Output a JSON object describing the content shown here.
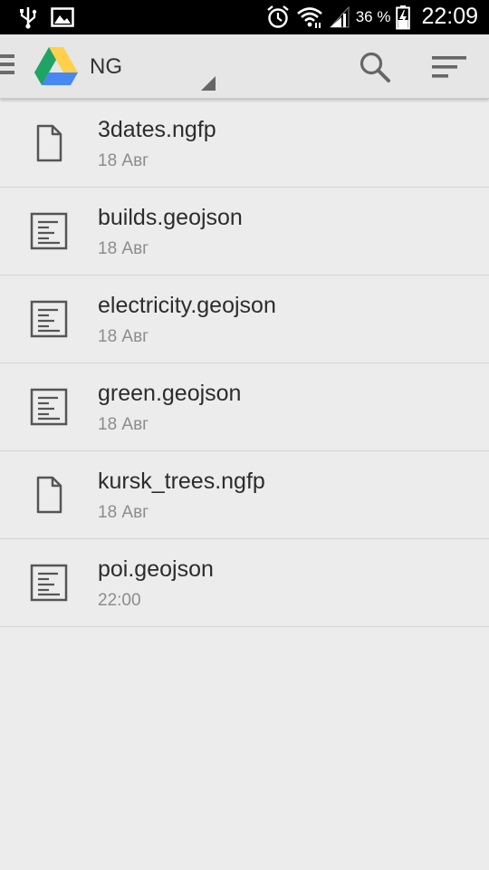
{
  "status_bar": {
    "battery_percent": "36 %",
    "time": "22:09",
    "icons": [
      "usb-icon",
      "image-icon",
      "alarm-icon",
      "wifi-icon",
      "signal-icon",
      "battery-charging-icon"
    ]
  },
  "app_bar": {
    "account": "NG",
    "icons": [
      "menu-icon",
      "drive-logo",
      "search-icon",
      "sort-icon"
    ]
  },
  "files": [
    {
      "name": "3dates.ngfp",
      "date": "18 Авг",
      "icon": "file-icon"
    },
    {
      "name": "builds.geojson",
      "date": "18 Авг",
      "icon": "text-document-icon"
    },
    {
      "name": "electricity.geojson",
      "date": "18 Авг",
      "icon": "text-document-icon"
    },
    {
      "name": "green.geojson",
      "date": "18 Авг",
      "icon": "text-document-icon"
    },
    {
      "name": "kursk_trees.ngfp",
      "date": "18 Авг",
      "icon": "file-icon"
    },
    {
      "name": "poi.geojson",
      "date": "22:00",
      "icon": "text-document-icon"
    }
  ],
  "colors": {
    "background": "#ececec",
    "app_bar": "#e6e6e6",
    "primary_text": "#2c2c2c",
    "secondary_text": "#8c8c8c",
    "drive_green": "#1fa463",
    "drive_yellow": "#ffd04b",
    "drive_blue": "#4688f4"
  }
}
